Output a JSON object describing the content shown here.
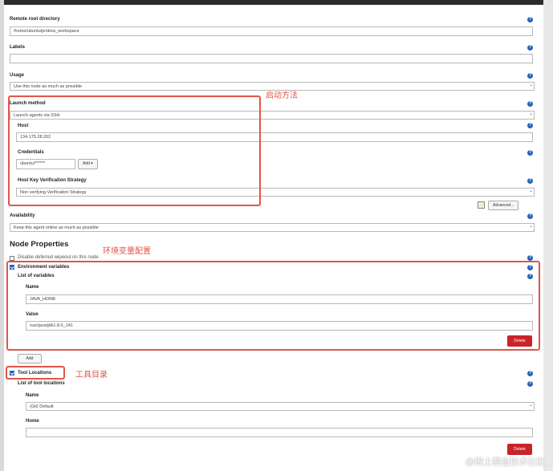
{
  "fields": {
    "remote_root": {
      "label": "Remote root directory",
      "value": "/home/ubuntu/jenkins_workspace"
    },
    "labels": {
      "label": "Labels",
      "value": ""
    },
    "usage": {
      "label": "Usage",
      "value": "Use this node as much as possible"
    },
    "launch_method": {
      "label": "Launch method",
      "value": "Launch agents via SSH"
    },
    "host": {
      "label": "Host",
      "value": "134.175.28.202"
    },
    "credentials": {
      "label": "Credentials",
      "value": "ubuntu/******",
      "add_label": "Add ▾"
    },
    "host_key": {
      "label": "Host Key Verification Strategy",
      "value": "Non verifying Verification Strategy"
    },
    "advanced_label": "Advanced...",
    "availability": {
      "label": "Availability",
      "value": "Keep this agent online as much as possible"
    }
  },
  "node_properties": {
    "title": "Node Properties",
    "disable_deferred_wipeout": "Disable deferred wipeout on this node",
    "env_vars": {
      "label": "Environment variables",
      "list_label": "List of variables",
      "name_label": "Name",
      "name_value": "JAVA_HOME",
      "value_label": "Value",
      "value_value": "/usr/java/jdk1.8.0_141",
      "delete_label": "Delete",
      "add_label": "Add"
    },
    "tool_locations": {
      "label": "Tool Locations",
      "list_label": "List of tool locations",
      "name_label": "Name",
      "name_value": "(Git) Default",
      "home_label": "Home",
      "home_value": "",
      "delete_label": "Delete"
    }
  },
  "annotations": {
    "launch": "启动方法",
    "env": "环境变量配置",
    "tools": "工具目录"
  },
  "help_glyph": "?",
  "watermark": "@稀土掘金技术社区",
  "colors": {
    "annotation": "#e0554a",
    "help": "#2862b6",
    "delete": "#c8242a"
  }
}
